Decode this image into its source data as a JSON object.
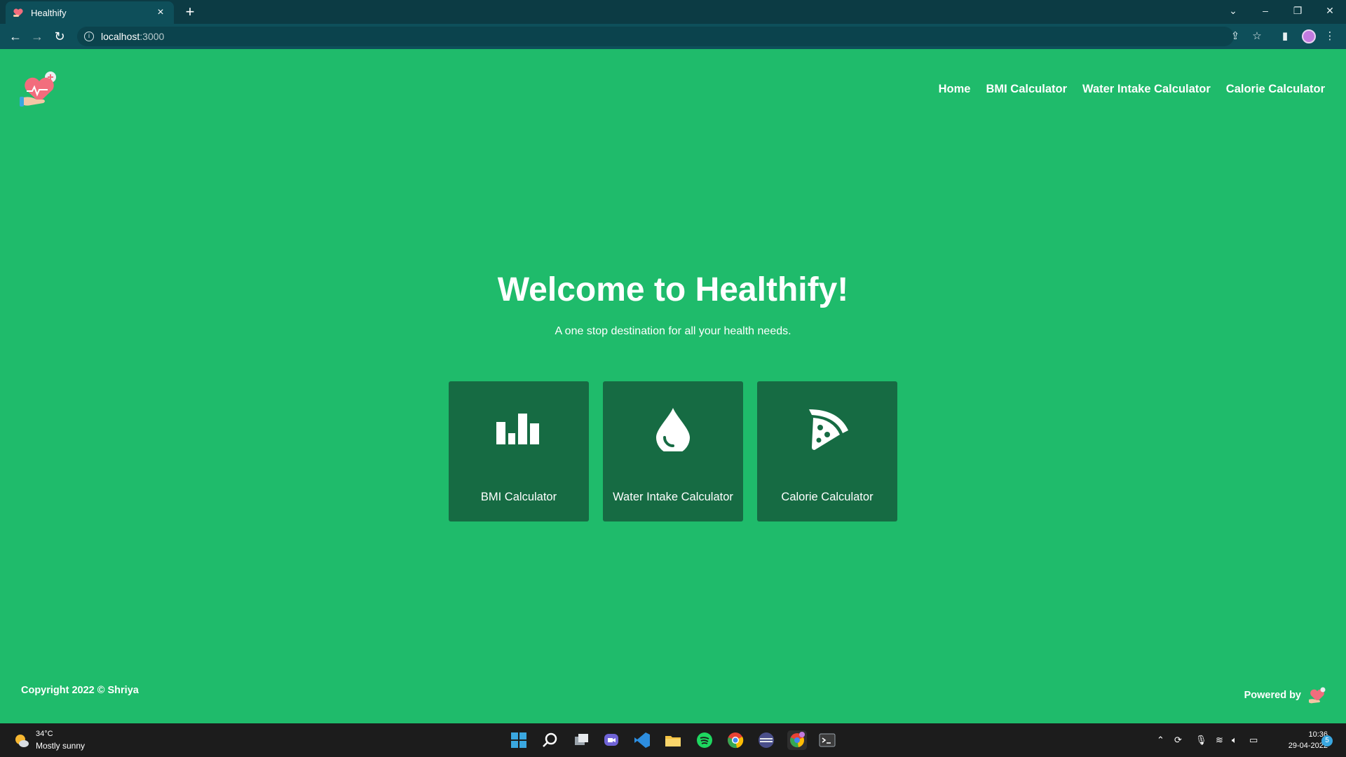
{
  "browser": {
    "tab_title": "Healthify",
    "tab_close": "×",
    "new_tab": "+",
    "url_host": "localhost",
    "url_port": ":3000"
  },
  "nav": {
    "links": [
      "Home",
      "BMI Calculator",
      "Water Intake Calculator",
      "Calorie Calculator"
    ]
  },
  "hero": {
    "title": "Welcome to Healthify!",
    "subtitle": "A one stop destination for all your health needs."
  },
  "cards": [
    {
      "label": "BMI Calculator",
      "icon": "bar-chart-icon"
    },
    {
      "label": "Water Intake Calculator",
      "icon": "water-drop-icon"
    },
    {
      "label": "Calorie Calculator",
      "icon": "pizza-icon"
    }
  ],
  "footer": {
    "copyright": "Copyright 2022 © Shriya",
    "powered_by": "Powered by"
  },
  "taskbar": {
    "temperature": "34°C",
    "condition": "Mostly sunny",
    "time": "10:36",
    "date": "29-04-2022",
    "notifications": "5"
  },
  "colors": {
    "page_bg": "#1fbb6b",
    "card_bg": "#166b43",
    "chrome_bg": "#0e4f5a"
  }
}
